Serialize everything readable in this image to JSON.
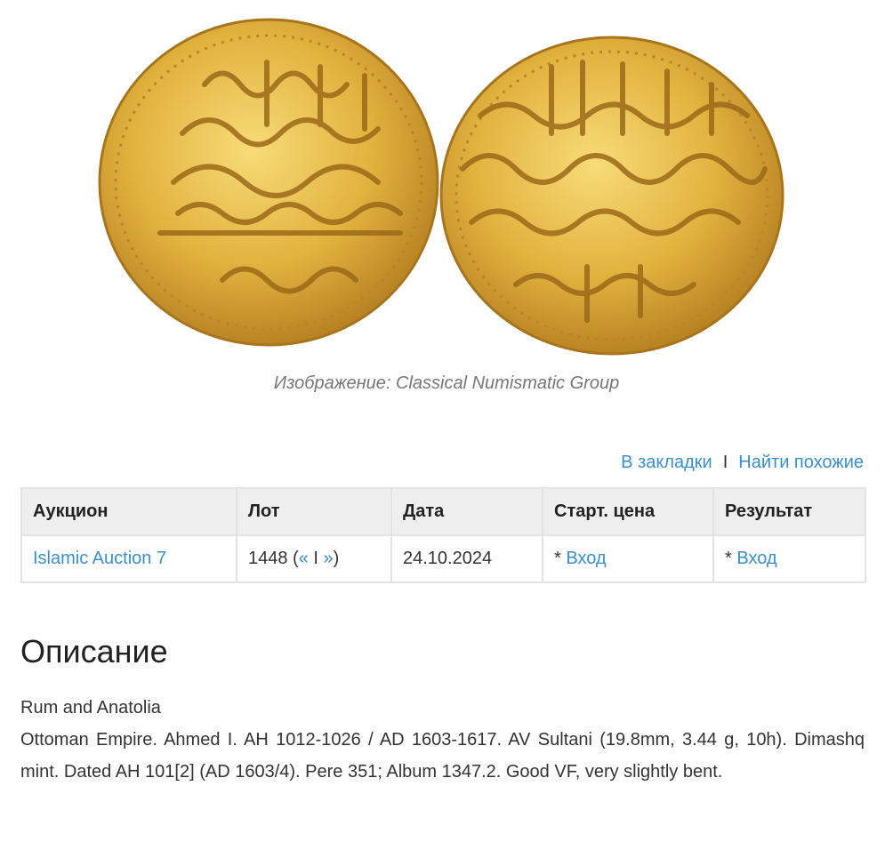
{
  "image": {
    "coins": [
      "obverse-coin",
      "reverse-coin"
    ],
    "colors": {
      "gold_light": "#f2cd5a",
      "gold": "#d9a632",
      "gold_dark": "#a8741c"
    },
    "caption": "Изображение: Classical Numismatic Group"
  },
  "actions": {
    "bookmark": "В закладки",
    "separator": "I",
    "find_similar": "Найти похожие"
  },
  "table": {
    "headers": [
      "Аукцион",
      "Лот",
      "Дата",
      "Старт. цена",
      "Результат"
    ],
    "row": {
      "auction": "Islamic Auction 7",
      "lot_number": "1448",
      "lot_open": " (",
      "prev": "«",
      "lot_sep": " I ",
      "next": "»",
      "lot_close": ")",
      "date": "24.10.2024",
      "start_prefix": "* ",
      "start_link": "Вход",
      "result_prefix": "* ",
      "result_link": "Вход"
    }
  },
  "description": {
    "title": "Описание",
    "category": "Rum and Anatolia",
    "text": "Ottoman Empire. Ahmed I. AH 1012-1026 / AD 1603-1617. AV Sultani (19.8mm, 3.44 g, 10h). Dimashq mint. Dated AH 101[2] (AD 1603/4). Pere 351; Album 1347.2. Good VF, very slightly bent."
  }
}
